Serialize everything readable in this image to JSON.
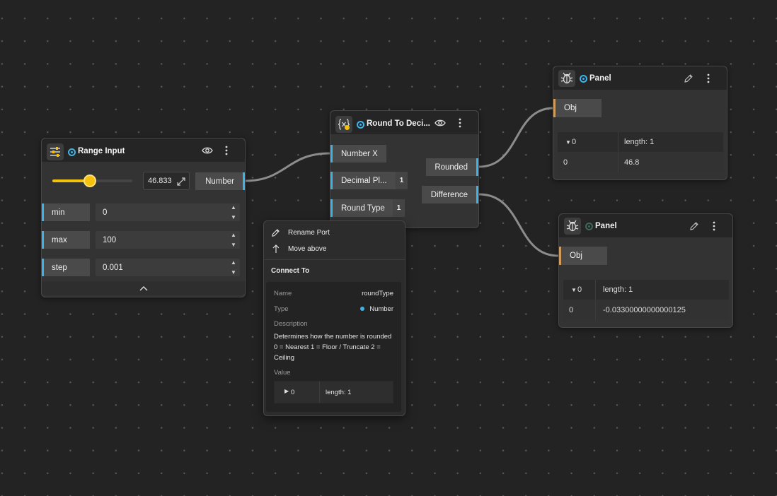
{
  "range_node": {
    "title": "Range Input",
    "slider_value": "46.833",
    "slider_fraction": 0.468,
    "output_port": "Number",
    "fields": [
      {
        "label": "min",
        "value": "0"
      },
      {
        "label": "max",
        "value": "100"
      },
      {
        "label": "step",
        "value": "0.001"
      }
    ]
  },
  "round_node": {
    "title": "Round To Deci...",
    "inputs": [
      {
        "label": "Number X",
        "badge": ""
      },
      {
        "label": "Decimal Pl...",
        "badge": "1"
      },
      {
        "label": "Round Type",
        "badge": "1"
      }
    ],
    "outputs": [
      {
        "label": "Rounded"
      },
      {
        "label": "Difference"
      }
    ]
  },
  "panel1": {
    "title": "Panel",
    "port": "Obj",
    "header_index": "0",
    "length": "length: 1",
    "row_index": "0",
    "row_value": "46.8"
  },
  "panel2": {
    "title": "Panel",
    "port": "Obj",
    "header_index": "0",
    "length": "length: 1",
    "row_index": "0",
    "row_value": "-0.03300000000000125"
  },
  "context_menu": {
    "rename": "Rename Port",
    "move_above": "Move above",
    "connect_to": "Connect To",
    "name_label": "Name",
    "name_value": "roundType",
    "type_label": "Type",
    "type_value": "Number",
    "description_label": "Description",
    "description_lines": [
      "Determines how the number is rounded",
      "0 = Nearest 1 = Floor / Truncate 2 =",
      "Ceiling"
    ],
    "value_label": "Value",
    "value_index": "0",
    "value_length": "length: 1"
  },
  "colors": {
    "canvas": "#232323",
    "port_accent": "#3fb3e6",
    "obj_accent": "#d09a5a",
    "slider_yellow": "#f4c20d",
    "wire": "#8c8c8c"
  },
  "icons": {
    "range_node": "sliders-icon",
    "round_node": "function-x-icon",
    "panel": "bug-icon",
    "visibility": "eye-icon",
    "menu": "kebab-icon",
    "edit": "pencil-icon",
    "collapse": "chevron-up-icon"
  }
}
